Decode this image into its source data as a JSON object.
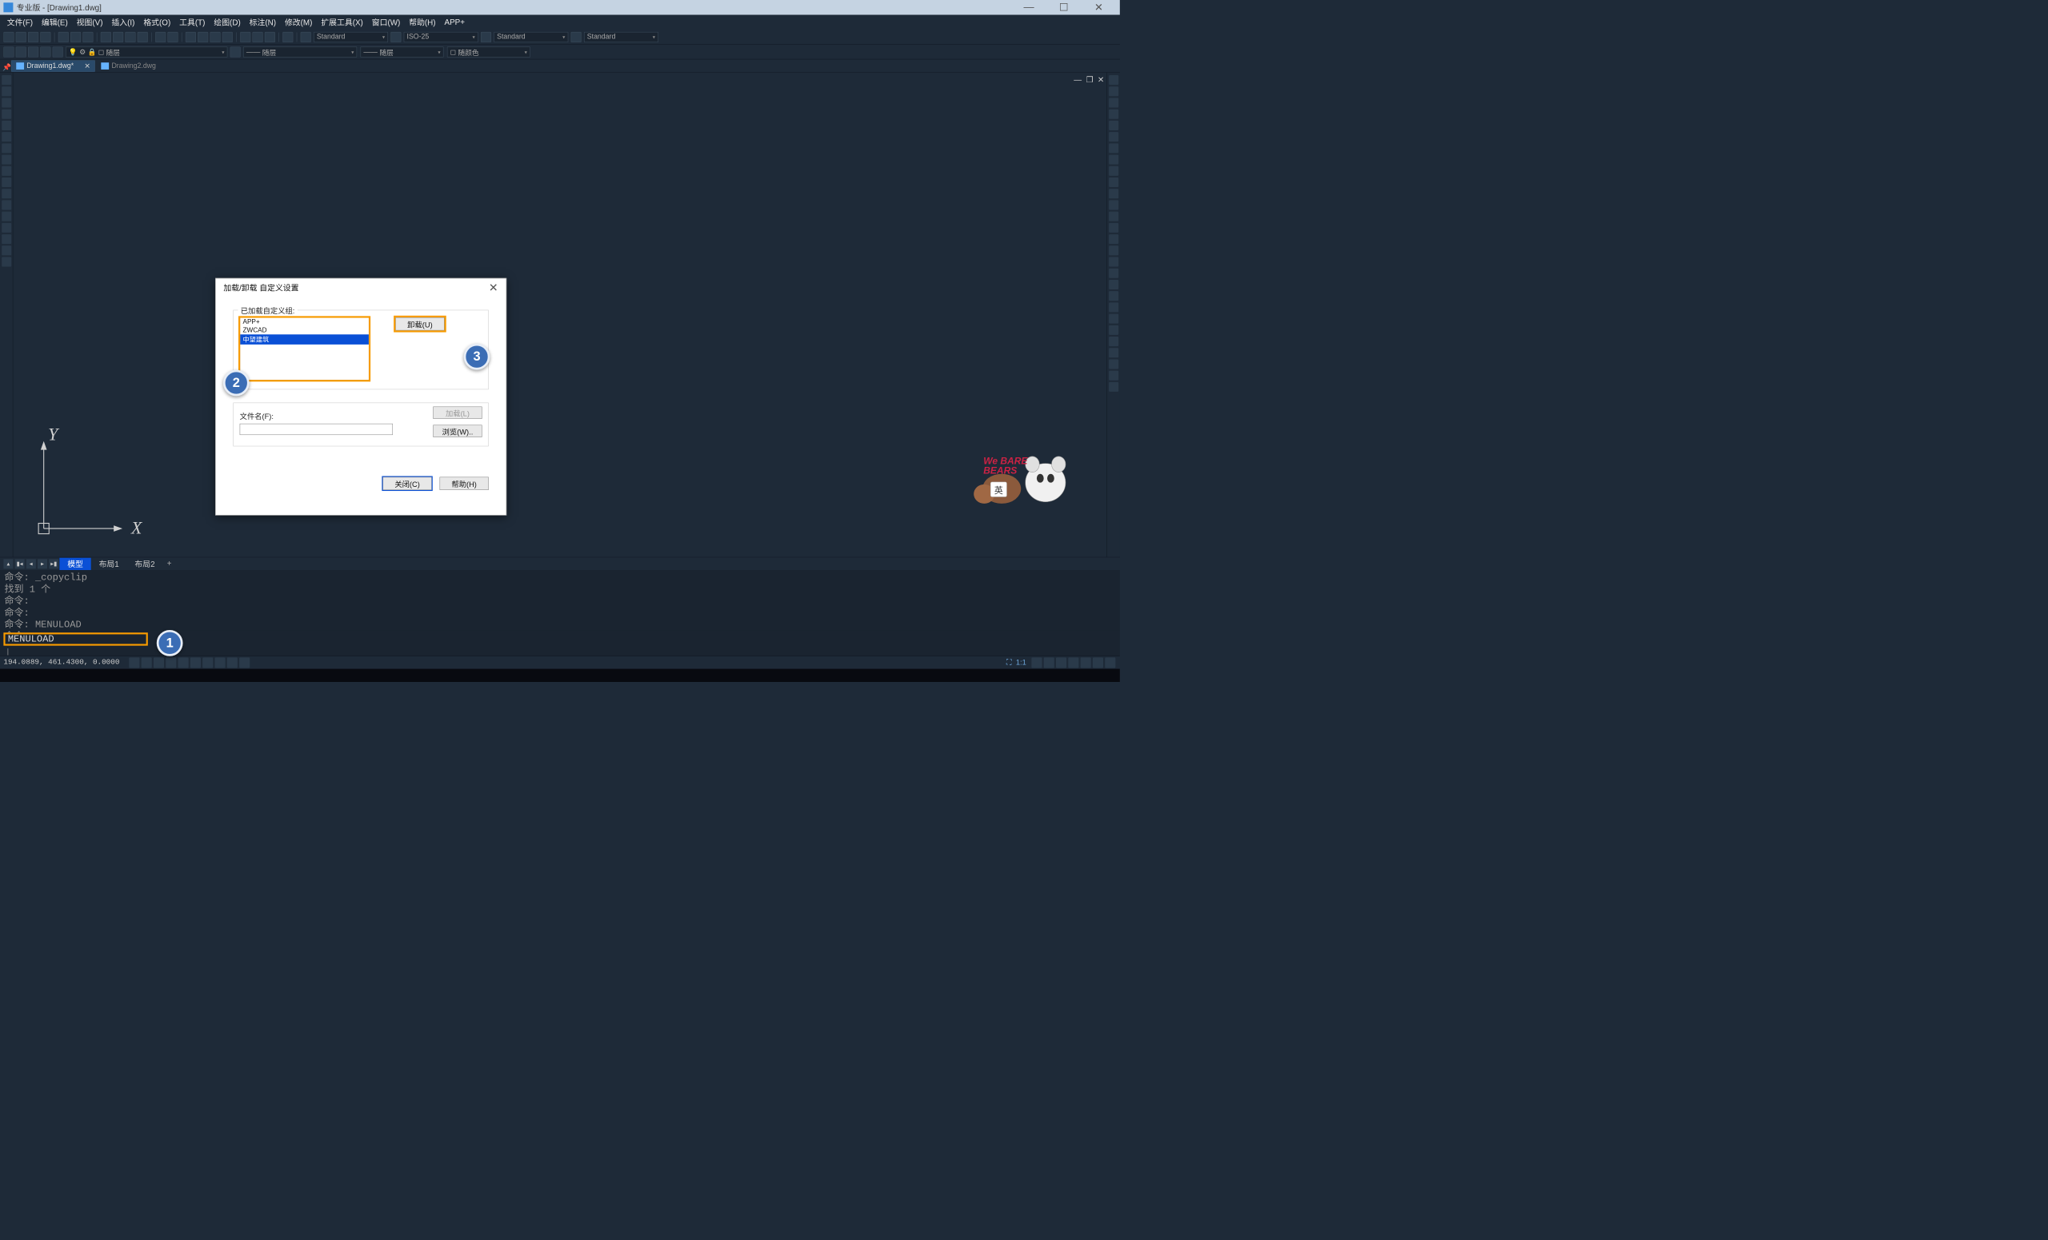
{
  "titlebar": {
    "text": "专业版 - [Drawing1.dwg]"
  },
  "menu": {
    "file": "文件(F)",
    "edit": "编辑(E)",
    "view": "视图(V)",
    "insert": "插入(I)",
    "format": "格式(O)",
    "tools": "工具(T)",
    "draw": "绘图(D)",
    "dim": "标注(N)",
    "modify": "修改(M)",
    "ext": "扩展工具(X)",
    "window": "窗口(W)",
    "help": "帮助(H)",
    "app": "APP+"
  },
  "combos": {
    "textstyle": "Standard",
    "dimstyle": "ISO-25",
    "tblstyle": "Standard",
    "mleader": "Standard",
    "layer1": "随层",
    "ltype": "随层",
    "lweight": "随层",
    "color": "随颜色"
  },
  "tabs": {
    "doc1": "Drawing1.dwg*",
    "doc2": "Drawing2.dwg"
  },
  "ucs": {
    "x": "X",
    "y": "Y"
  },
  "dialog": {
    "title": "加载/卸载 自定义设置",
    "group1_label": "已加载自定义组:",
    "list": {
      "item1": "APP+",
      "item2": "ZWCAD",
      "item3": "中望建筑"
    },
    "unload_btn": "卸载(U)",
    "filename_label": "文件名(F):",
    "load_btn": "加载(L)",
    "browse_btn": "浏览(W)..",
    "close_btn": "关闭(C)",
    "help_btn": "帮助(H)"
  },
  "annotations": {
    "b1": "1",
    "b2": "2",
    "b3": "3"
  },
  "layout_tabs": {
    "model": "模型",
    "layout1": "布局1",
    "layout2": "布局2"
  },
  "cmd": {
    "history": "命令: _copyclip\n找到 1 个\n命令:\n命令:\n命令: MENULOAD\n命令:",
    "input": "MENULOAD"
  },
  "status": {
    "coords": "194.0889, 461.4300, 0.0000",
    "scale": "1:1"
  },
  "ime": {
    "tag": "英"
  }
}
